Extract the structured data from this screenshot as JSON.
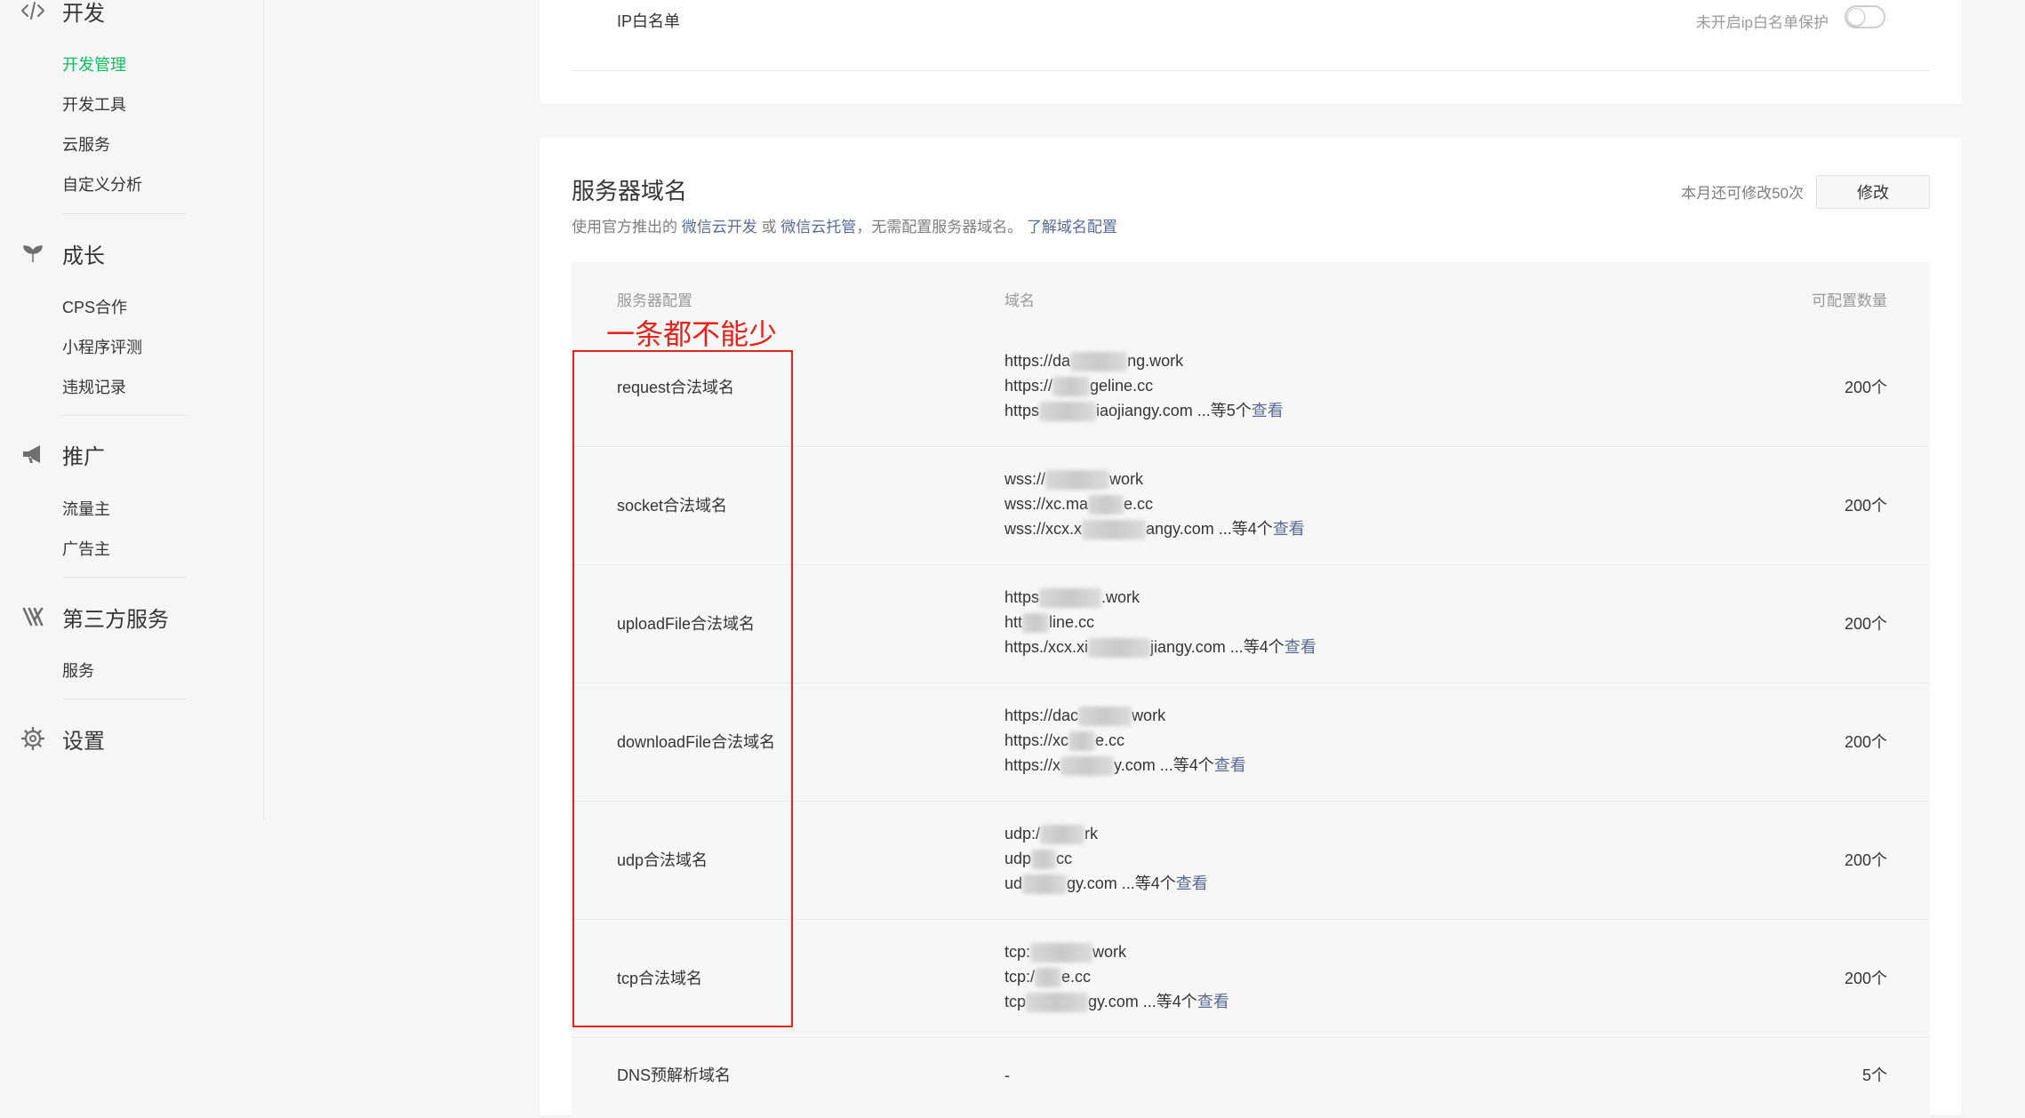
{
  "sidebar": {
    "groups": [
      {
        "title": "开发",
        "icon": "code-icon",
        "items": [
          {
            "label": "开发管理",
            "active": true
          },
          {
            "label": "开发工具"
          },
          {
            "label": "云服务"
          },
          {
            "label": "自定义分析"
          }
        ]
      },
      {
        "title": "成长",
        "icon": "sprout-icon",
        "items": [
          {
            "label": "CPS合作"
          },
          {
            "label": "小程序评测"
          },
          {
            "label": "违规记录"
          }
        ]
      },
      {
        "title": "推广",
        "icon": "megaphone-icon",
        "items": [
          {
            "label": "流量主"
          },
          {
            "label": "广告主"
          }
        ]
      },
      {
        "title": "第三方服务",
        "icon": "third-party-icon",
        "items": [
          {
            "label": "服务"
          }
        ]
      },
      {
        "title": "设置",
        "icon": "gear-icon",
        "items": []
      }
    ]
  },
  "ip_whitelist": {
    "label": "IP白名单",
    "status": "未开启ip白名单保护",
    "enabled": false
  },
  "server_domain": {
    "title": "服务器域名",
    "desc_prefix": "使用官方推出的",
    "link_cloud_dev": "微信云开发",
    "desc_or": "或",
    "link_cloud_host": "微信云托管",
    "desc_mid": "，无需配置服务器域名。",
    "link_learn": "了解域名配置",
    "modify_note": "本月还可修改50次",
    "modify_button": "修改",
    "columns": {
      "config": "服务器配置",
      "domain": "域名",
      "qty": "可配置数量"
    },
    "rows": [
      {
        "config": "request合法域名",
        "qty": "200个",
        "lines": [
          {
            "a": "https://da",
            "b": "ng.work"
          },
          {
            "a": "https://",
            "b": "geline.cc"
          },
          {
            "a": "https",
            "b": "iaojiangy.com"
          }
        ],
        "more": "...等5个",
        "view": "查看"
      },
      {
        "config": "socket合法域名",
        "qty": "200个",
        "lines": [
          {
            "a": "wss://",
            "b": "work"
          },
          {
            "a": "wss://xc.ma",
            "b": "e.cc"
          },
          {
            "a": "wss://xcx.x",
            "b": "angy.com"
          }
        ],
        "more": "...等4个",
        "view": "查看"
      },
      {
        "config": "uploadFile合法域名",
        "qty": "200个",
        "lines": [
          {
            "a": "https",
            "b": ".work"
          },
          {
            "a": "htt",
            "b": "line.cc"
          },
          {
            "a": "https./xcx.xi",
            "b": "jiangy.com"
          }
        ],
        "more": "...等4个",
        "view": "查看"
      },
      {
        "config": "downloadFile合法域名",
        "qty": "200个",
        "lines": [
          {
            "a": "https://dac",
            "b": "work"
          },
          {
            "a": "https://xc",
            "b": "e.cc"
          },
          {
            "a": "https://x",
            "b": "y.com"
          }
        ],
        "more": "...等4个",
        "view": "查看"
      },
      {
        "config": "udp合法域名",
        "qty": "200个",
        "lines": [
          {
            "a": "udp:/",
            "b": "rk"
          },
          {
            "a": "udp",
            "b": "cc"
          },
          {
            "a": "ud",
            "b": "gy.com"
          }
        ],
        "more": "...等4个",
        "view": "查看"
      },
      {
        "config": "tcp合法域名",
        "qty": "200个",
        "lines": [
          {
            "a": "tcp:",
            "b": "work"
          },
          {
            "a": "tcp:/",
            "b": "e.cc"
          },
          {
            "a": "tcp",
            "b": "gy.com"
          }
        ],
        "more": "...等4个",
        "view": "查看"
      }
    ],
    "dns_row": {
      "config": "DNS预解析域名",
      "domain": "-",
      "qty": "5个"
    }
  },
  "annotation": {
    "text": "一条都不能少",
    "color": "#e5231a"
  },
  "colors": {
    "accent": "#07c160",
    "link": "#576b95"
  }
}
